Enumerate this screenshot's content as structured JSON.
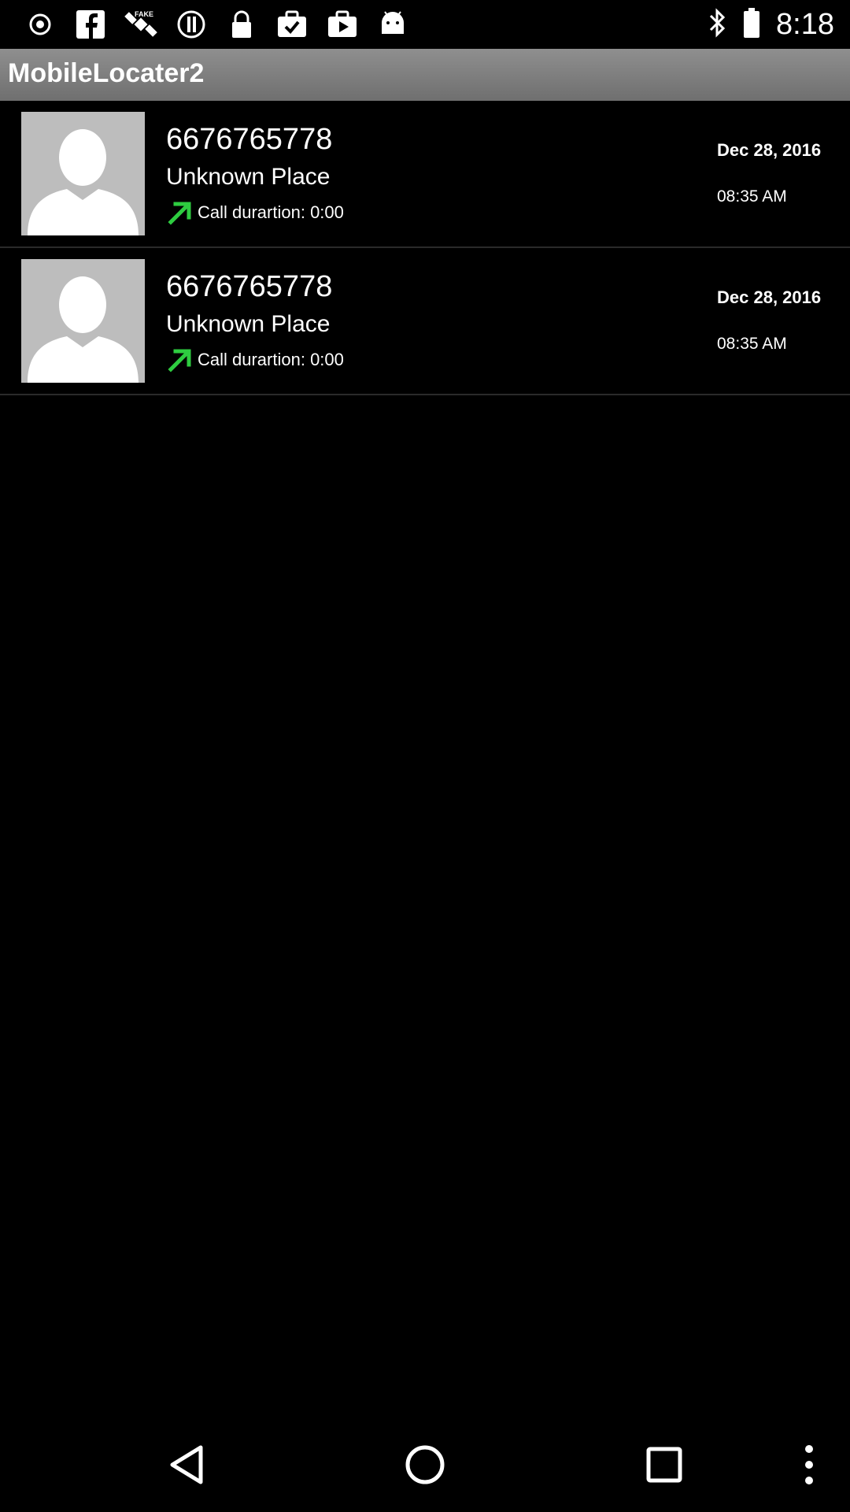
{
  "status_bar": {
    "time": "8:18",
    "left_icons": [
      "record-icon",
      "facebook-icon",
      "satellite-icon",
      "sync-icon",
      "lock-icon",
      "briefcase-check-icon",
      "shopping-bag-icon",
      "android-icon"
    ],
    "right_icons": [
      "bluetooth-icon",
      "battery-icon"
    ]
  },
  "app": {
    "title": "MobileLocater2"
  },
  "calls": [
    {
      "number": "6676765778",
      "place": "Unknown Place",
      "duration": "Call durartion: 0:00",
      "date": "Dec 28, 2016",
      "time": "08:35 AM",
      "direction_icon": "outgoing-call-arrow-icon",
      "accent_color": "#2ecc40"
    },
    {
      "number": "6676765778",
      "place": "Unknown Place",
      "duration": "Call durartion: 0:00",
      "date": "Dec 28, 2016",
      "time": "08:35 AM",
      "direction_icon": "outgoing-call-arrow-icon",
      "accent_color": "#2ecc40"
    }
  ],
  "nav_bar": {
    "buttons": [
      "back-icon",
      "home-icon",
      "recents-icon",
      "overflow-menu-icon"
    ]
  }
}
